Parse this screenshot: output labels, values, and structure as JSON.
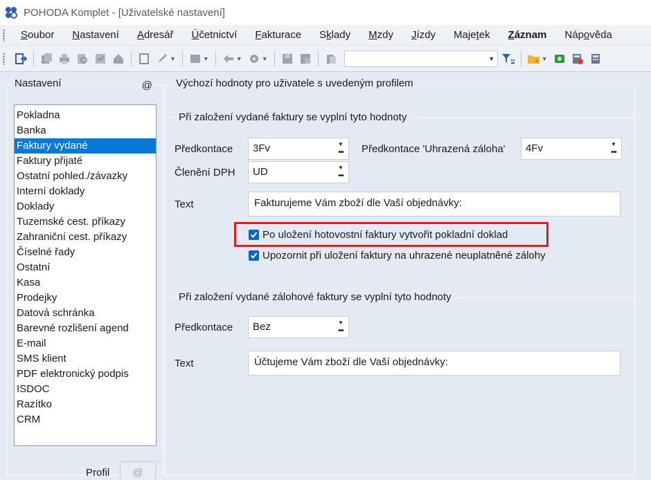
{
  "window": {
    "title": "POHODA Komplet - [Uživatelské nastavení]"
  },
  "menu": [
    {
      "pre": "",
      "u": "S",
      "post": "oubor",
      "bold": false
    },
    {
      "pre": "",
      "u": "N",
      "post": "astavení",
      "bold": false
    },
    {
      "pre": "",
      "u": "A",
      "post": "dresář",
      "bold": false
    },
    {
      "pre": "",
      "u": "Ú",
      "post": "četnictví",
      "bold": false
    },
    {
      "pre": "",
      "u": "F",
      "post": "akturace",
      "bold": false
    },
    {
      "pre": "S",
      "u": "k",
      "post": "lady",
      "bold": false
    },
    {
      "pre": "",
      "u": "M",
      "post": "zdy",
      "bold": false
    },
    {
      "pre": "",
      "u": "J",
      "post": "ízdy",
      "bold": false
    },
    {
      "pre": "Maje",
      "u": "t",
      "post": "ek",
      "bold": false
    },
    {
      "pre": "",
      "u": "Z",
      "post": "áznam",
      "bold": true
    },
    {
      "pre": "Náp",
      "u": "o",
      "post": "věda",
      "bold": false
    }
  ],
  "left": {
    "legend": "Nastavení",
    "at": "@",
    "items": [
      "Pokladna",
      "Banka",
      "Faktury vydané",
      "Faktury přijaté",
      "Ostatní pohled./závazky",
      "Interní doklady",
      "Doklady",
      "Tuzemské cest. příkazy",
      "Zahraniční cest. příkazy",
      "Číselné řady",
      "Ostatní",
      "Kasa",
      "Prodejky",
      "Datová schránka",
      "Barevné rozlišení agend",
      "E-mail",
      "SMS klient",
      "PDF elektronický podpis",
      "ISDOC",
      "Razítko",
      "CRM"
    ],
    "selected_index": 2,
    "profil_label": "Profil",
    "profil_value": "@"
  },
  "right": {
    "legend": "Výchozí hodnoty pro uživatele s uvedeným profilem",
    "invoice": {
      "title": "Při založení vydané faktury se vyplní tyto hodnoty",
      "predkontace_label": "Předkontace",
      "predkontace_value": "3Fv",
      "predkontace_zaloha_label": "Předkontace 'Uhrazená záloha'",
      "predkontace_zaloha_value": "4Fv",
      "cleneni_label": "Členění DPH",
      "cleneni_value": "UD",
      "text_label": "Text",
      "text_value": "Fakturujeme Vám zboží dle Vaší objednávky:",
      "check1": "Po uložení hotovostní faktury vytvořit pokladní doklad",
      "check2": "Upozornit při uložení faktury na uhrazené neuplatněné zálohy"
    },
    "advance": {
      "title": "Při založení vydané zálohové faktury se vyplní tyto hodnoty",
      "predkontace_label": "Předkontace",
      "predkontace_value": "Bez",
      "text_label": "Text",
      "text_value": "Účtujeme Vám zboží dle Vaší objednávky:"
    }
  }
}
